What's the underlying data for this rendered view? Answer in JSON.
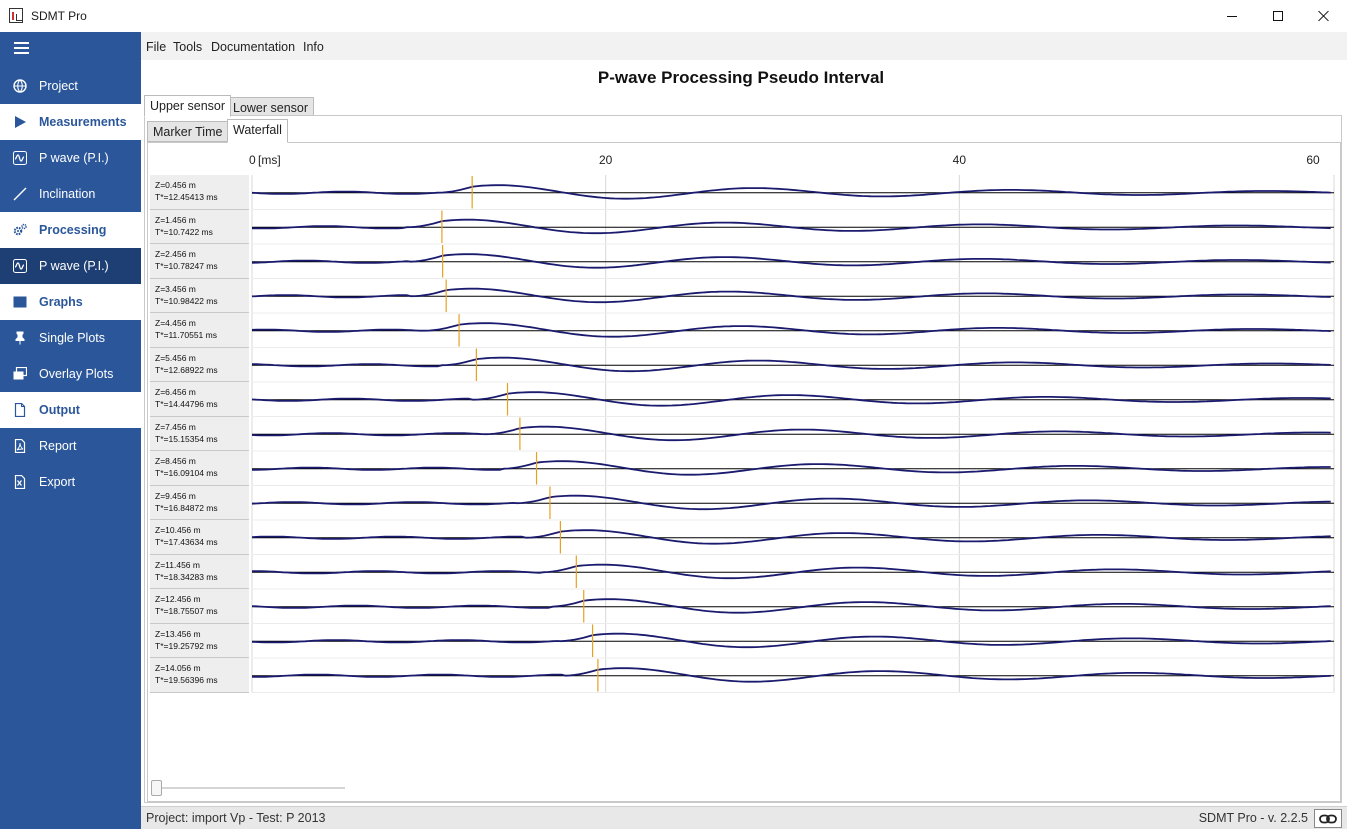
{
  "window": {
    "title": "SDMT Pro"
  },
  "sidebar": {
    "items": [
      {
        "label": "Project",
        "icon": "globe-icon",
        "kind": "item"
      },
      {
        "label": "Measurements",
        "icon": "play-icon",
        "kind": "section"
      },
      {
        "label": "P wave (P.I.)",
        "icon": "wave-icon",
        "kind": "item"
      },
      {
        "label": "Inclination",
        "icon": "slash-icon",
        "kind": "item"
      },
      {
        "label": "Processing",
        "icon": "gears-icon",
        "kind": "section"
      },
      {
        "label": "P wave (P.I.)",
        "icon": "wave-icon",
        "kind": "active"
      },
      {
        "label": "Graphs",
        "icon": "image-icon",
        "kind": "section"
      },
      {
        "label": "Single Plots",
        "icon": "pin-icon",
        "kind": "item"
      },
      {
        "label": "Overlay Plots",
        "icon": "overlay-icon",
        "kind": "item"
      },
      {
        "label": "Output",
        "icon": "file-icon",
        "kind": "section"
      },
      {
        "label": "Report",
        "icon": "pdf-icon",
        "kind": "item"
      },
      {
        "label": "Export",
        "icon": "excel-icon",
        "kind": "item"
      }
    ]
  },
  "menu": [
    "File",
    "Tools",
    "Documentation",
    "Info"
  ],
  "page": {
    "title": "P-wave Processing Pseudo Interval"
  },
  "sensor_tabs": [
    "Upper sensor",
    "Lower sensor"
  ],
  "view_tabs": [
    "Marker Time",
    "Waterfall"
  ],
  "chart_data": {
    "type": "line",
    "x_axis": {
      "ticks": [
        0,
        20,
        40,
        60
      ],
      "zero_label": "0",
      "unit_label": "[ms]",
      "range": [
        0,
        61
      ]
    },
    "line_color": "#1a1a6e",
    "marker_color": "#e8a020",
    "traces": [
      {
        "depth": "Z=0.456 m",
        "time": "T*=12.45413 ms",
        "marker_ms": 12.45
      },
      {
        "depth": "Z=1.456 m",
        "time": "T*=10.7422 ms",
        "marker_ms": 10.74
      },
      {
        "depth": "Z=2.456 m",
        "time": "T*=10.78247 ms",
        "marker_ms": 10.78
      },
      {
        "depth": "Z=3.456 m",
        "time": "T*=10.98422 ms",
        "marker_ms": 10.98
      },
      {
        "depth": "Z=4.456 m",
        "time": "T*=11.70551 ms",
        "marker_ms": 11.71
      },
      {
        "depth": "Z=5.456 m",
        "time": "T*=12.68922 ms",
        "marker_ms": 12.69
      },
      {
        "depth": "Z=6.456 m",
        "time": "T*=14.44796 ms",
        "marker_ms": 14.45
      },
      {
        "depth": "Z=7.456 m",
        "time": "T*=15.15354 ms",
        "marker_ms": 15.15
      },
      {
        "depth": "Z=8.456 m",
        "time": "T*=16.09104 ms",
        "marker_ms": 16.09
      },
      {
        "depth": "Z=9.456 m",
        "time": "T*=16.84872 ms",
        "marker_ms": 16.85
      },
      {
        "depth": "Z=10.456 m",
        "time": "T*=17.43634 ms",
        "marker_ms": 17.44
      },
      {
        "depth": "Z=11.456 m",
        "time": "T*=18.34283 ms",
        "marker_ms": 18.34
      },
      {
        "depth": "Z=12.456 m",
        "time": "T*=18.75507 ms",
        "marker_ms": 18.76
      },
      {
        "depth": "Z=13.456 m",
        "time": "T*=19.25792 ms",
        "marker_ms": 19.26
      },
      {
        "depth": "Z=14.056 m",
        "time": "T*=19.56396 ms",
        "marker_ms": 19.56
      }
    ]
  },
  "status": {
    "left": "Project: import Vp - Test: P 2013",
    "right": "SDMT Pro - v. 2.2.5",
    "link_icon": "link-icon"
  }
}
